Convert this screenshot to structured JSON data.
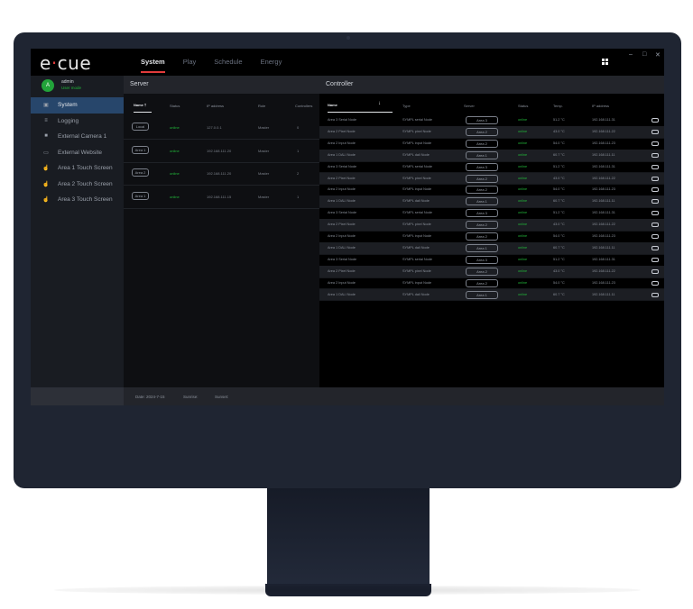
{
  "app": {
    "logo": {
      "text_before": "e",
      "text_dot": "·",
      "text_after": "cue"
    },
    "tabs": [
      {
        "label": "System",
        "active": true
      },
      {
        "label": "Play",
        "active": false
      },
      {
        "label": "Schedule",
        "active": false
      },
      {
        "label": "Energy",
        "active": false
      }
    ],
    "window_controls": {
      "minimize": "–",
      "restore": "□",
      "close": "✕"
    }
  },
  "user": {
    "avatar_letter": "A",
    "name": "admin",
    "role": "User mode"
  },
  "sidebar": {
    "items": [
      {
        "label": "System",
        "icon": "system-icon",
        "active": true
      },
      {
        "label": "Logging",
        "icon": "list-icon",
        "active": false
      },
      {
        "label": "External Camera 1",
        "icon": "camera-icon",
        "active": false
      },
      {
        "label": "External Website",
        "icon": "browser-icon",
        "active": false
      },
      {
        "label": "Area 1 Touch Screen",
        "icon": "touch-icon",
        "active": false
      },
      {
        "label": "Area 2 Touch Screen",
        "icon": "touch-icon",
        "active": false
      },
      {
        "label": "Area 3 Touch Screen",
        "icon": "touch-icon",
        "active": false
      }
    ]
  },
  "server": {
    "title": "Server",
    "columns": [
      "Name",
      "Status",
      "IP address",
      "Role",
      "Controllers"
    ],
    "rows": [
      {
        "name": "Local",
        "status": "online",
        "ip": "127.0.0.1",
        "role": "Master",
        "controllers": "0"
      },
      {
        "name": "Area 1",
        "status": "online",
        "ip": "192.168.111.20",
        "role": "Master",
        "controllers": "1"
      },
      {
        "name": "Area 2",
        "status": "online",
        "ip": "192.168.111.20",
        "role": "Master",
        "controllers": "2"
      },
      {
        "name": "Area 1",
        "status": "online",
        "ip": "192.168.111.15",
        "role": "Master",
        "controllers": "1"
      }
    ]
  },
  "controller": {
    "title": "Controller",
    "columns": [
      "Name",
      "Type",
      "Server",
      "Status",
      "Temp.",
      "IP address"
    ],
    "rows": [
      {
        "name": "Area 3 Serial Node",
        "type": "SYMPL serial Node",
        "server": "Area 3",
        "status": "online",
        "temp": "51.2 °C",
        "ip": "192.168.111.31"
      },
      {
        "name": "Area 2 Pixel Node",
        "type": "SYMPL pixel Node",
        "server": "Area 2",
        "status": "online",
        "temp": "43.0 °C",
        "ip": "192.168.111.22"
      },
      {
        "name": "Area 2 Input Node",
        "type": "SYMPL input Node",
        "server": "Area 2",
        "status": "online",
        "temp": "54.0 °C",
        "ip": "192.168.111.23"
      },
      {
        "name": "Area 1 DALI Node",
        "type": "SYMPL dali Node",
        "server": "Area 1",
        "status": "online",
        "temp": "60.7 °C",
        "ip": "192.168.111.11"
      },
      {
        "name": "Area 3 Serial Node",
        "type": "SYMPL serial Node",
        "server": "Area 3",
        "status": "online",
        "temp": "51.2 °C",
        "ip": "192.168.111.31"
      },
      {
        "name": "Area 2 Pixel Node",
        "type": "SYMPL pixel Node",
        "server": "Area 2",
        "status": "online",
        "temp": "43.0 °C",
        "ip": "192.168.111.22"
      },
      {
        "name": "Area 2 Input Node",
        "type": "SYMPL input Node",
        "server": "Area 2",
        "status": "online",
        "temp": "54.0 °C",
        "ip": "192.168.111.23"
      },
      {
        "name": "Area 1 DALI Node",
        "type": "SYMPL dali Node",
        "server": "Area 1",
        "status": "online",
        "temp": "60.7 °C",
        "ip": "192.168.111.11"
      },
      {
        "name": "Area 3 Serial Node",
        "type": "SYMPL serial Node",
        "server": "Area 3",
        "status": "online",
        "temp": "51.2 °C",
        "ip": "192.168.111.31"
      },
      {
        "name": "Area 2 Pixel Node",
        "type": "SYMPL pixel Node",
        "server": "Area 2",
        "status": "online",
        "temp": "43.0 °C",
        "ip": "192.168.111.22"
      },
      {
        "name": "Area 2 Input Node",
        "type": "SYMPL input Node",
        "server": "Area 2",
        "status": "online",
        "temp": "54.0 °C",
        "ip": "192.168.111.23"
      },
      {
        "name": "Area 1 DALI Node",
        "type": "SYMPL dali Node",
        "server": "Area 1",
        "status": "online",
        "temp": "60.7 °C",
        "ip": "192.168.111.11"
      },
      {
        "name": "Area 3 Serial Node",
        "type": "SYMPL serial Node",
        "server": "Area 3",
        "status": "online",
        "temp": "51.2 °C",
        "ip": "192.168.111.31"
      },
      {
        "name": "Area 2 Pixel Node",
        "type": "SYMPL pixel Node",
        "server": "Area 2",
        "status": "online",
        "temp": "43.0 °C",
        "ip": "192.168.111.22"
      },
      {
        "name": "Area 2 Input Node",
        "type": "SYMPL input Node",
        "server": "Area 2",
        "status": "online",
        "temp": "54.0 °C",
        "ip": "192.168.111.23"
      },
      {
        "name": "Area 1 DALI Node",
        "type": "SYMPL dali Node",
        "server": "Area 1",
        "status": "online",
        "temp": "60.7 °C",
        "ip": "192.168.111.11"
      }
    ]
  },
  "statusbar": {
    "date": "Date: 2024-7-15",
    "sunrise": "Sunrise:",
    "sunset": "Sunset:"
  },
  "colors": {
    "accent": "#e23b3b",
    "online": "#22b83a",
    "active_nav": "#27466b"
  }
}
